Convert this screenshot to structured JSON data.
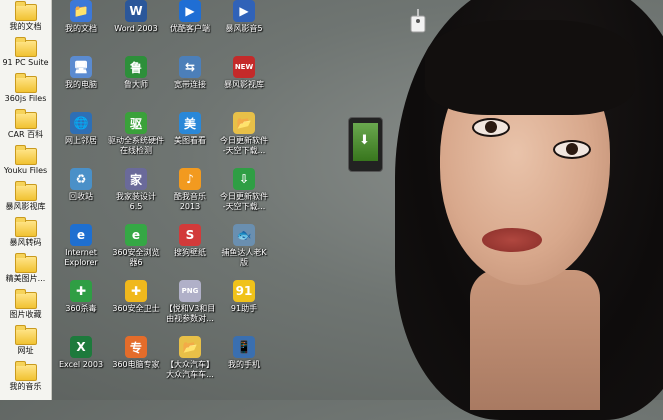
{
  "sidebar": {
    "items": [
      {
        "label": "我的文档"
      },
      {
        "label": "91 PC Suite"
      },
      {
        "label": "360js Files"
      },
      {
        "label": "CAR 百科"
      },
      {
        "label": "Youku Files"
      },
      {
        "label": "暴风影视库"
      },
      {
        "label": "暴风转码"
      },
      {
        "label": "精美图片..."
      },
      {
        "label": "图片收藏"
      },
      {
        "label": "网址"
      },
      {
        "label": "我的音乐"
      }
    ]
  },
  "desktop": {
    "columns": [
      [
        {
          "label": "我的文档",
          "icon": "documents-icon",
          "color": "#3c78d8",
          "glyph": "📁"
        },
        {
          "label": "我的电脑",
          "icon": "computer-icon",
          "color": "#5b8bd0",
          "glyph": "🖥"
        },
        {
          "label": "网上邻居",
          "icon": "network-icon",
          "color": "#2e6fb5",
          "glyph": "🌐"
        },
        {
          "label": "回收站",
          "icon": "recycle-bin-icon",
          "color": "#4a90c8",
          "glyph": "♻"
        },
        {
          "label": "Internet\nExplorer",
          "icon": "internet-explorer-icon",
          "color": "#1e6fd0",
          "glyph": "e"
        },
        {
          "label": "360杀毒",
          "icon": "antivirus-icon",
          "color": "#2f9e44",
          "glyph": "✚"
        },
        {
          "label": "Excel 2003",
          "icon": "excel-icon",
          "color": "#1d7a3c",
          "glyph": "X"
        }
      ],
      [
        {
          "label": "Word 2003",
          "icon": "word-icon",
          "color": "#2b579a",
          "glyph": "W"
        },
        {
          "label": "鲁大师",
          "icon": "ludashi-icon",
          "color": "#2d8f3a",
          "glyph": "鲁"
        },
        {
          "label": "驱动全系统硬件\n在线检测",
          "icon": "driver-icon",
          "color": "#3aa13a",
          "glyph": "驱"
        },
        {
          "label": "我家装设计\n6.5",
          "icon": "home-design-icon",
          "color": "#6a6a9a",
          "glyph": "家"
        },
        {
          "label": "360安全浏览\n器6",
          "icon": "browser-360-icon",
          "color": "#35a845",
          "glyph": "e"
        },
        {
          "label": "360安全卫士",
          "icon": "security-guard-icon",
          "color": "#f0b81c",
          "glyph": "✚"
        },
        {
          "label": "360电脑专家",
          "icon": "pc-expert-icon",
          "color": "#e46c2a",
          "glyph": "专"
        }
      ],
      [
        {
          "label": "优酷客户端",
          "icon": "youku-icon",
          "color": "#1f6ed4",
          "glyph": "▶"
        },
        {
          "label": "宽带连接",
          "icon": "broadband-icon",
          "color": "#4c7fb9",
          "glyph": "⇆"
        },
        {
          "label": "美图看看",
          "icon": "meitu-icon",
          "color": "#2a88d8",
          "glyph": "美"
        },
        {
          "label": "酷我音乐\n2013",
          "icon": "kuwo-icon",
          "color": "#f29a1f",
          "glyph": "♪"
        },
        {
          "label": "搜狗壁纸",
          "icon": "sogou-wallpaper-icon",
          "color": "#d23a3a",
          "glyph": "S"
        },
        {
          "label": "【悦和V3和目\n由视参数对...",
          "icon": "png-file-icon",
          "color": "#b0b0c8",
          "glyph": "PNG"
        },
        {
          "label": "【大众汽车】\n大众汽车车...",
          "icon": "folder-icon",
          "color": "#e8c048",
          "glyph": "📂"
        }
      ],
      [
        {
          "label": "暴风影音5",
          "icon": "baofeng-icon",
          "color": "#3062b8",
          "glyph": "▶"
        },
        {
          "label": "暴风影视库",
          "icon": "baofeng-library-icon",
          "color": "#c42a2a",
          "glyph": "NEW"
        },
        {
          "label": "今日更新软件\n-天空下载...",
          "icon": "folder-icon",
          "color": "#e8c048",
          "glyph": "📂"
        },
        {
          "label": "今日更新软件\n-天空下载...",
          "icon": "skydown-icon",
          "color": "#2f9e44",
          "glyph": "⇩"
        },
        {
          "label": "捕鱼达人老K\n版",
          "icon": "fishing-game-icon",
          "color": "#6a8fb0",
          "glyph": "🐟"
        },
        {
          "label": "91助手",
          "icon": "91-assistant-icon",
          "color": "#f0c21a",
          "glyph": "91"
        },
        {
          "label": "我的手机",
          "icon": "my-phone-icon",
          "color": "#3a6fb0",
          "glyph": "📱"
        }
      ]
    ]
  }
}
